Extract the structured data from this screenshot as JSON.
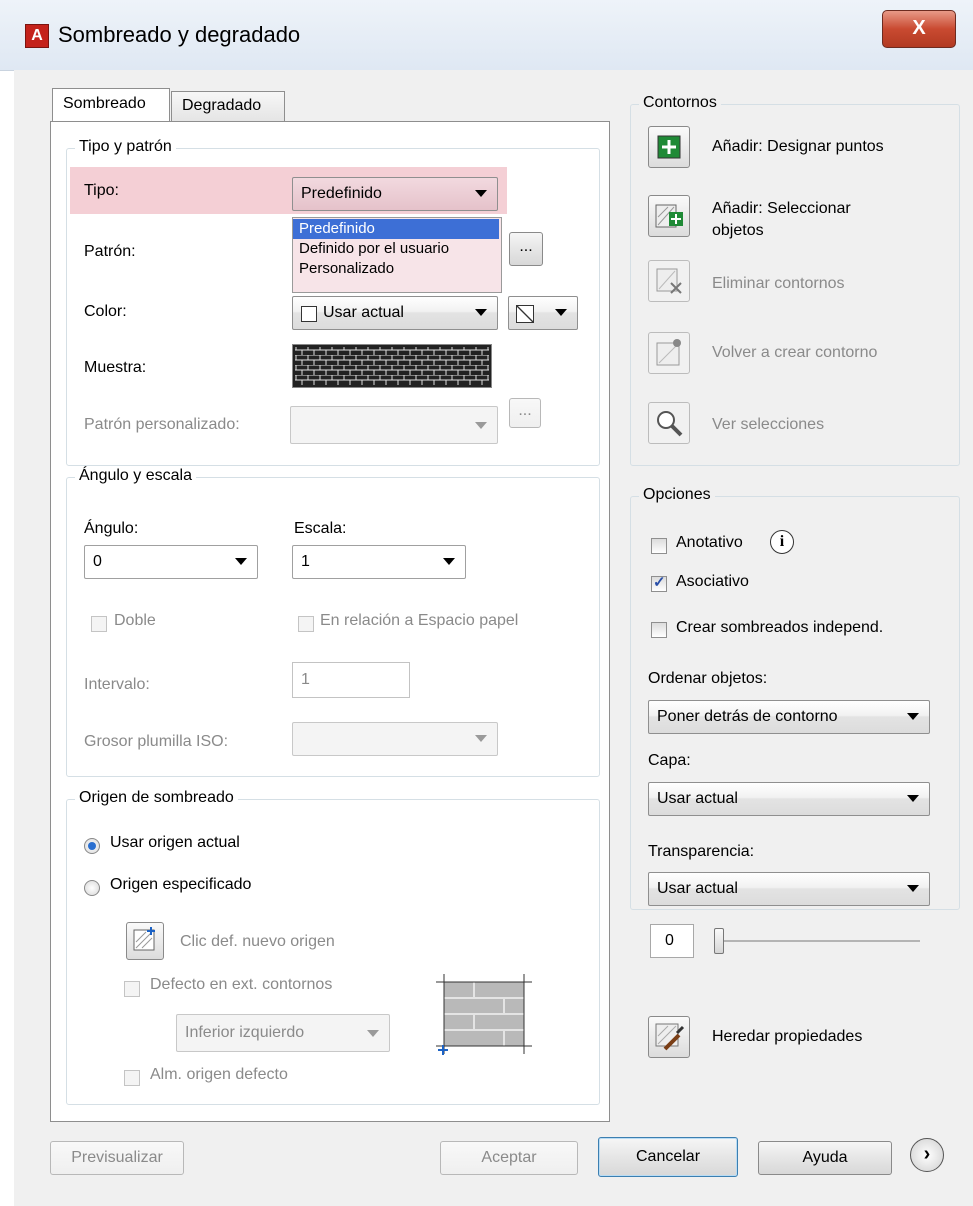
{
  "window": {
    "title": "Sombreado y degradado",
    "close_glyph": "X"
  },
  "tabs": [
    {
      "label": "Sombreado",
      "active": true
    },
    {
      "label": "Degradado",
      "active": false
    }
  ],
  "tipo_patron": {
    "group_title": "Tipo y patrón",
    "tipo_label": "Tipo:",
    "tipo_value": "Predefinido",
    "tipo_options": [
      "Predefinido",
      "Definido por el usuario",
      "Personalizado"
    ],
    "patron_label": "Patrón:",
    "patron_browse": "...",
    "color_label": "Color:",
    "color_value": "Usar actual",
    "color_swatch_value": "",
    "muestra_label": "Muestra:",
    "patron_personalizado_label": "Patrón personalizado:",
    "patron_personalizado_value": "",
    "patron_personalizado_browse": "..."
  },
  "angulo_escala": {
    "group_title": "Ángulo y escala",
    "angulo_label": "Ángulo:",
    "angulo_value": "0",
    "escala_label": "Escala:",
    "escala_value": "1",
    "doble_label": "Doble",
    "relacion_label": "En relación a Espacio papel",
    "intervalo_label": "Intervalo:",
    "intervalo_value": "1",
    "grosor_label": "Grosor plumilla ISO:",
    "grosor_value": ""
  },
  "origen": {
    "group_title": "Origen de sombreado",
    "usar_origen_label": "Usar origen actual",
    "origen_especificado_label": "Origen especificado",
    "clic_nuevo_label": "Clic def. nuevo origen",
    "defecto_label": "Defecto en ext. contornos",
    "posicion_value": "Inferior izquierdo",
    "alm_label": "Alm. origen defecto"
  },
  "contornos": {
    "group_title": "Contornos",
    "items": [
      {
        "label": "Añadir: Designar puntos",
        "enabled": true
      },
      {
        "label": "Añadir: Seleccionar objetos",
        "enabled": true
      },
      {
        "label": "Eliminar contornos",
        "enabled": false
      },
      {
        "label": "Volver a crear contorno",
        "enabled": false
      },
      {
        "label": "Ver selecciones",
        "enabled": false
      }
    ]
  },
  "opciones": {
    "group_title": "Opciones",
    "anotativo_label": "Anotativo",
    "asociativo_label": "Asociativo",
    "independ_label": "Crear sombreados independ.",
    "ordenar_label": "Ordenar objetos:",
    "ordenar_value": "Poner detrás de contorno",
    "capa_label": "Capa:",
    "capa_value": "Usar actual",
    "transparencia_label": "Transparencia:",
    "transparencia_value": "Usar actual",
    "transparencia_number": "0",
    "transparencia_level": 0
  },
  "heredar_label": "Heredar propiedades",
  "footer": {
    "previsualizar": "Previsualizar",
    "aceptar": "Aceptar",
    "cancelar": "Cancelar",
    "ayuda": "Ayuda"
  },
  "colors": {
    "highlight": "#f4cfd5",
    "selected": "#3d6fd6",
    "dropdown_bg": "#f7e4e8"
  }
}
